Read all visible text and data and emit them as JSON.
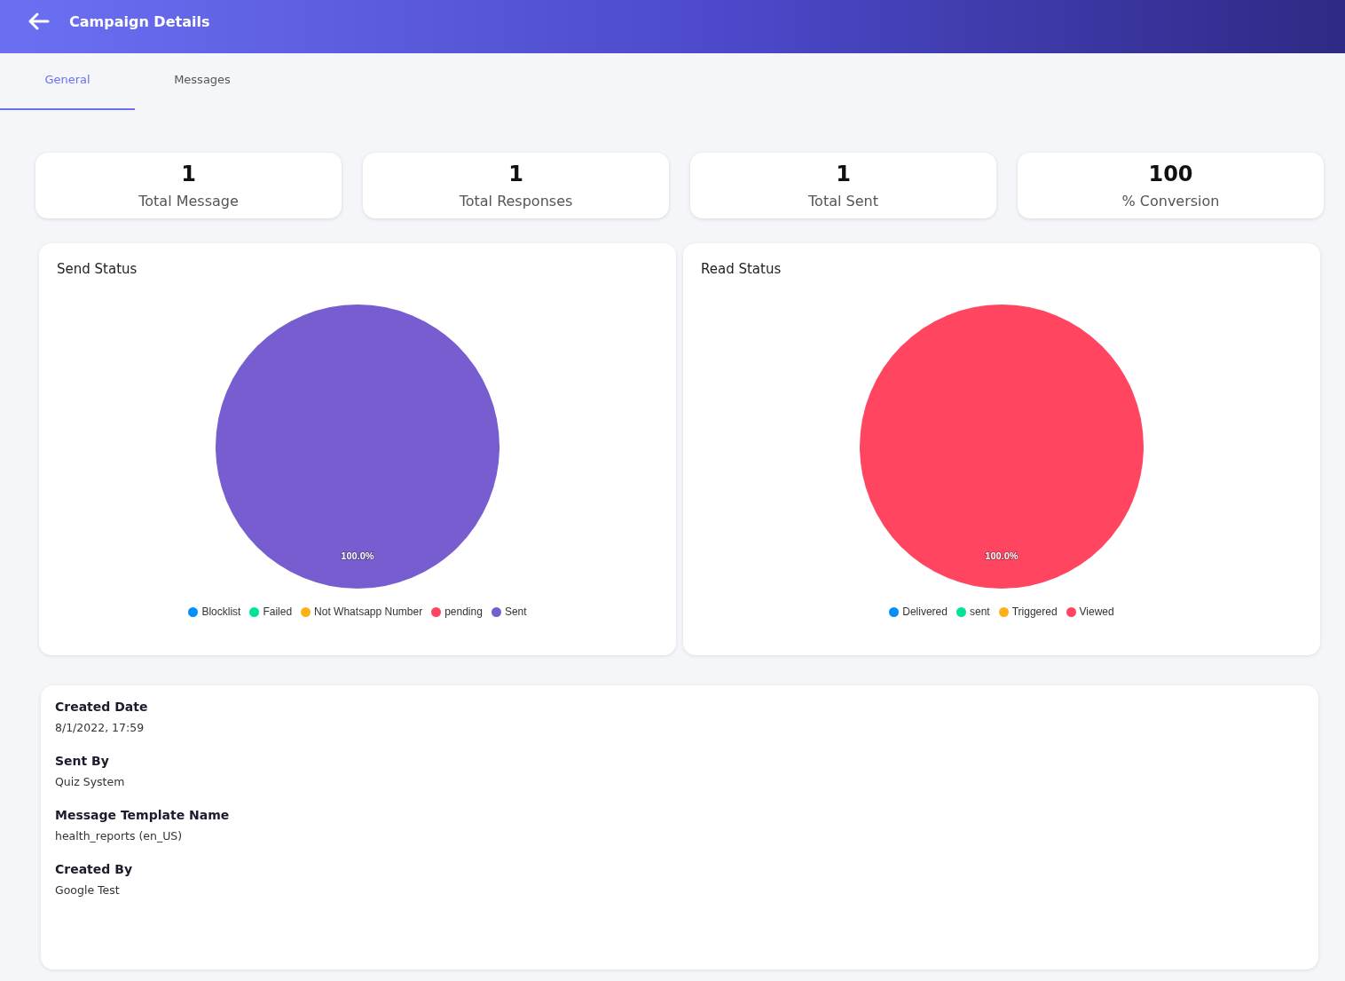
{
  "header": {
    "title": "Campaign Details"
  },
  "tabs": [
    {
      "label": "General",
      "selected": true
    },
    {
      "label": "Messages",
      "selected": false
    }
  ],
  "stats": [
    {
      "value": "1",
      "label": "Total Message"
    },
    {
      "value": "1",
      "label": "Total Responses"
    },
    {
      "value": "1",
      "label": "Total Sent"
    },
    {
      "value": "100",
      "label": "% Conversion"
    }
  ],
  "charts": [
    {
      "chart_data": {
        "type": "pie",
        "title": "Send Status",
        "categories": [
          "Blocklist",
          "Failed",
          "Not Whatsapp Number",
          "pending",
          "Sent"
        ],
        "values": [
          0,
          0,
          0,
          0,
          100
        ],
        "value_labels": [
          null,
          null,
          null,
          null,
          "100.0%"
        ]
      },
      "legend": [
        {
          "color": "#008ffb"
        },
        {
          "color": "#00e396"
        },
        {
          "color": "#feb019"
        },
        {
          "color": "#ff4560"
        },
        {
          "color": "#775dd0"
        }
      ]
    },
    {
      "chart_data": {
        "type": "pie",
        "title": "Read Status",
        "categories": [
          "Delivered",
          "sent",
          "Triggered",
          "Viewed"
        ],
        "values": [
          0,
          0,
          0,
          100
        ],
        "value_labels": [
          null,
          null,
          null,
          "100.0%"
        ]
      },
      "legend": [
        {
          "color": "#008ffb"
        },
        {
          "color": "#00e396"
        },
        {
          "color": "#feb019"
        },
        {
          "color": "#ff4560"
        }
      ]
    }
  ],
  "details": [
    {
      "label": "Created Date",
      "value": "8/1/2022, 17:59"
    },
    {
      "label": "Sent By",
      "value": "Quiz System"
    },
    {
      "label": "Message Template Name",
      "value": "health_reports (en_US)"
    },
    {
      "label": "Created By",
      "value": "Google Test"
    }
  ]
}
